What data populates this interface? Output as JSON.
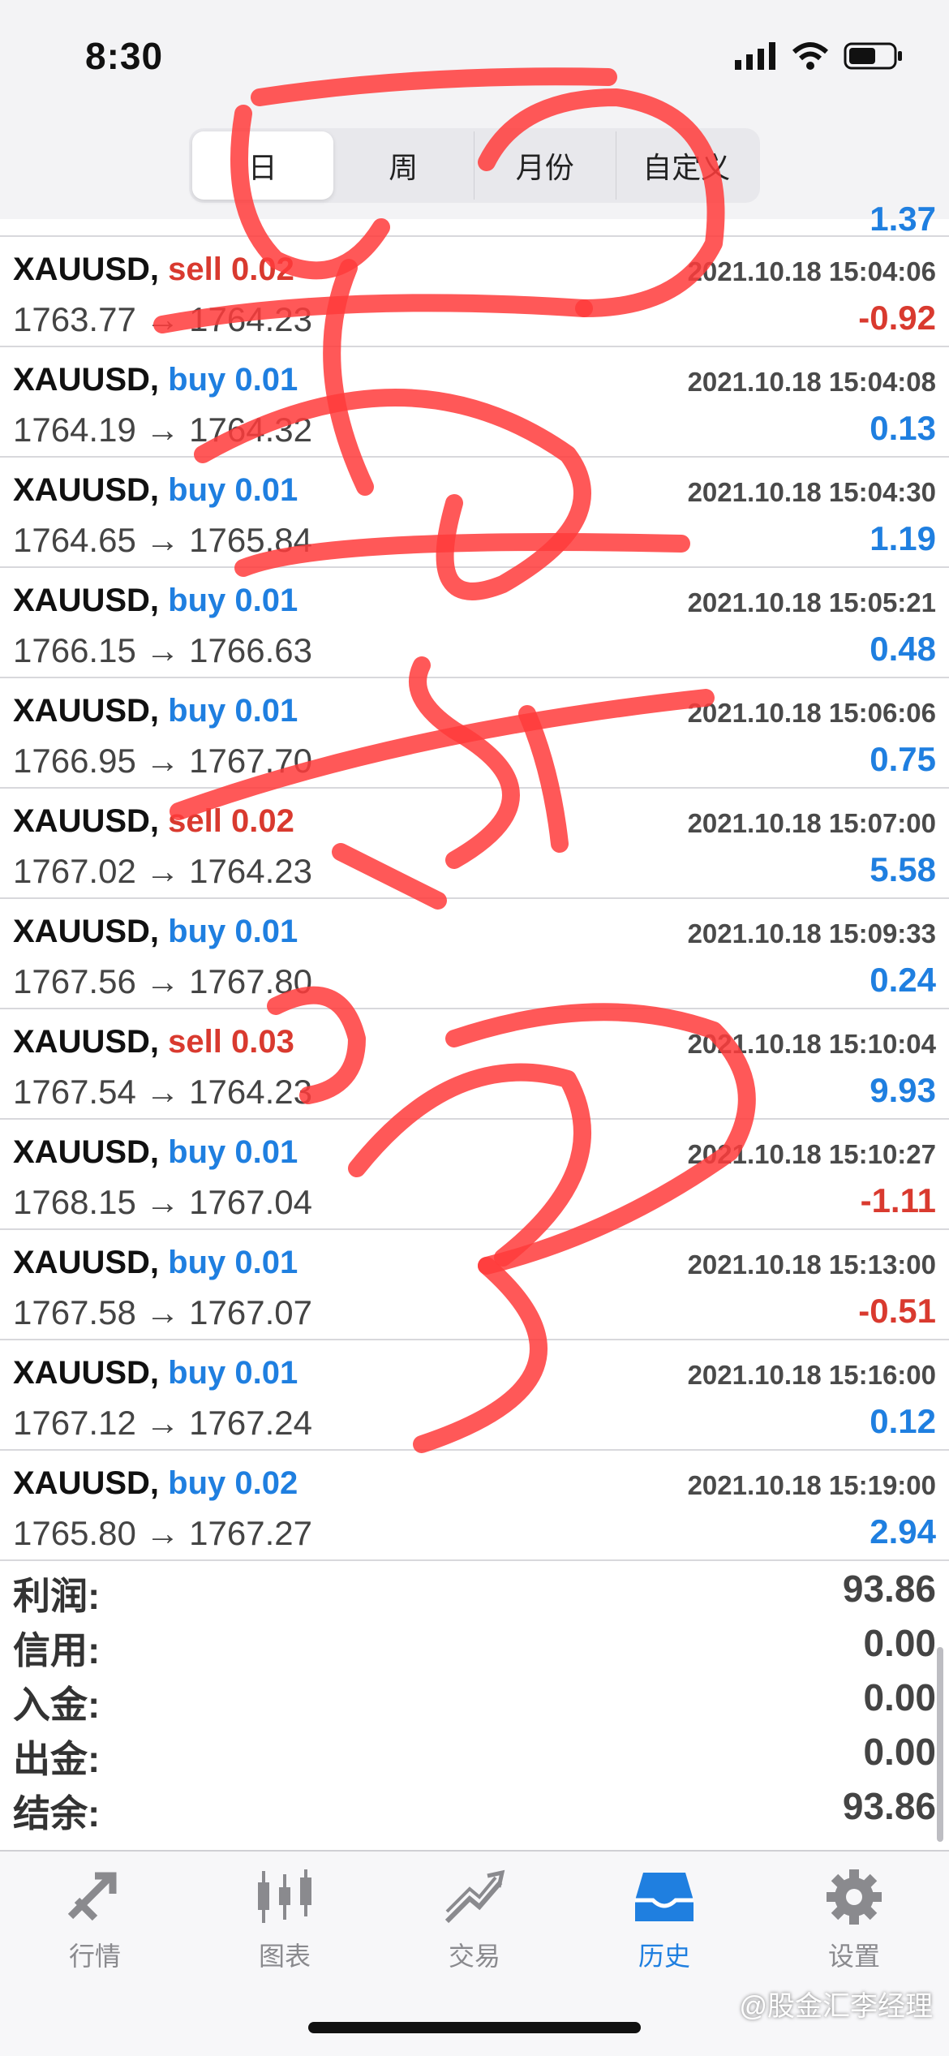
{
  "status": {
    "time": "8:30"
  },
  "segments": [
    {
      "label": "日",
      "active": true
    },
    {
      "label": "周",
      "active": false
    },
    {
      "label": "月份",
      "active": false
    },
    {
      "label": "自定义",
      "active": false
    }
  ],
  "partial_row": {
    "profit": "1.37"
  },
  "trades": [
    {
      "symbol": "XAUUSD,",
      "type": "sell 0.02",
      "side": "sell",
      "time": "2021.10.18 15:04:06",
      "prices": "1763.77 → 1764.23",
      "profit": "-0.92"
    },
    {
      "symbol": "XAUUSD,",
      "type": "buy 0.01",
      "side": "buy",
      "time": "2021.10.18 15:04:08",
      "prices": "1764.19 → 1764.32",
      "profit": "0.13"
    },
    {
      "symbol": "XAUUSD,",
      "type": "buy 0.01",
      "side": "buy",
      "time": "2021.10.18 15:04:30",
      "prices": "1764.65 → 1765.84",
      "profit": "1.19"
    },
    {
      "symbol": "XAUUSD,",
      "type": "buy 0.01",
      "side": "buy",
      "time": "2021.10.18 15:05:21",
      "prices": "1766.15 → 1766.63",
      "profit": "0.48"
    },
    {
      "symbol": "XAUUSD,",
      "type": "buy 0.01",
      "side": "buy",
      "time": "2021.10.18 15:06:06",
      "prices": "1766.95 → 1767.70",
      "profit": "0.75"
    },
    {
      "symbol": "XAUUSD,",
      "type": "sell 0.02",
      "side": "sell",
      "time": "2021.10.18 15:07:00",
      "prices": "1767.02 → 1764.23",
      "profit": "5.58"
    },
    {
      "symbol": "XAUUSD,",
      "type": "buy 0.01",
      "side": "buy",
      "time": "2021.10.18 15:09:33",
      "prices": "1767.56 → 1767.80",
      "profit": "0.24"
    },
    {
      "symbol": "XAUUSD,",
      "type": "sell 0.03",
      "side": "sell",
      "time": "2021.10.18 15:10:04",
      "prices": "1767.54 → 1764.23",
      "profit": "9.93"
    },
    {
      "symbol": "XAUUSD,",
      "type": "buy 0.01",
      "side": "buy",
      "time": "2021.10.18 15:10:27",
      "prices": "1768.15 → 1767.04",
      "profit": "-1.11"
    },
    {
      "symbol": "XAUUSD,",
      "type": "buy 0.01",
      "side": "buy",
      "time": "2021.10.18 15:13:00",
      "prices": "1767.58 → 1767.07",
      "profit": "-0.51"
    },
    {
      "symbol": "XAUUSD,",
      "type": "buy 0.01",
      "side": "buy",
      "time": "2021.10.18 15:16:00",
      "prices": "1767.12 → 1767.24",
      "profit": "0.12"
    },
    {
      "symbol": "XAUUSD,",
      "type": "buy 0.02",
      "side": "buy",
      "time": "2021.10.18 15:19:00",
      "prices": "1765.80 → 1767.27",
      "profit": "2.94"
    }
  ],
  "summary": [
    {
      "label": "利润:",
      "value": "93.86"
    },
    {
      "label": "信用:",
      "value": "0.00"
    },
    {
      "label": "入金:",
      "value": "0.00"
    },
    {
      "label": "出金:",
      "value": "0.00"
    },
    {
      "label": "结余:",
      "value": "93.86"
    }
  ],
  "tabs": [
    {
      "label": "行情",
      "icon": "quotes-icon",
      "active": false
    },
    {
      "label": "图表",
      "icon": "chart-icon",
      "active": false
    },
    {
      "label": "交易",
      "icon": "trade-icon",
      "active": false
    },
    {
      "label": "历史",
      "icon": "history-icon",
      "active": true
    },
    {
      "label": "设置",
      "icon": "settings-icon",
      "active": false
    }
  ],
  "watermark": "@股金汇李经理",
  "colors": {
    "buy": "#1f7fe0",
    "sell": "#d93a2f",
    "accent": "#1f7fe0",
    "scribble": "#ff3b3b"
  }
}
